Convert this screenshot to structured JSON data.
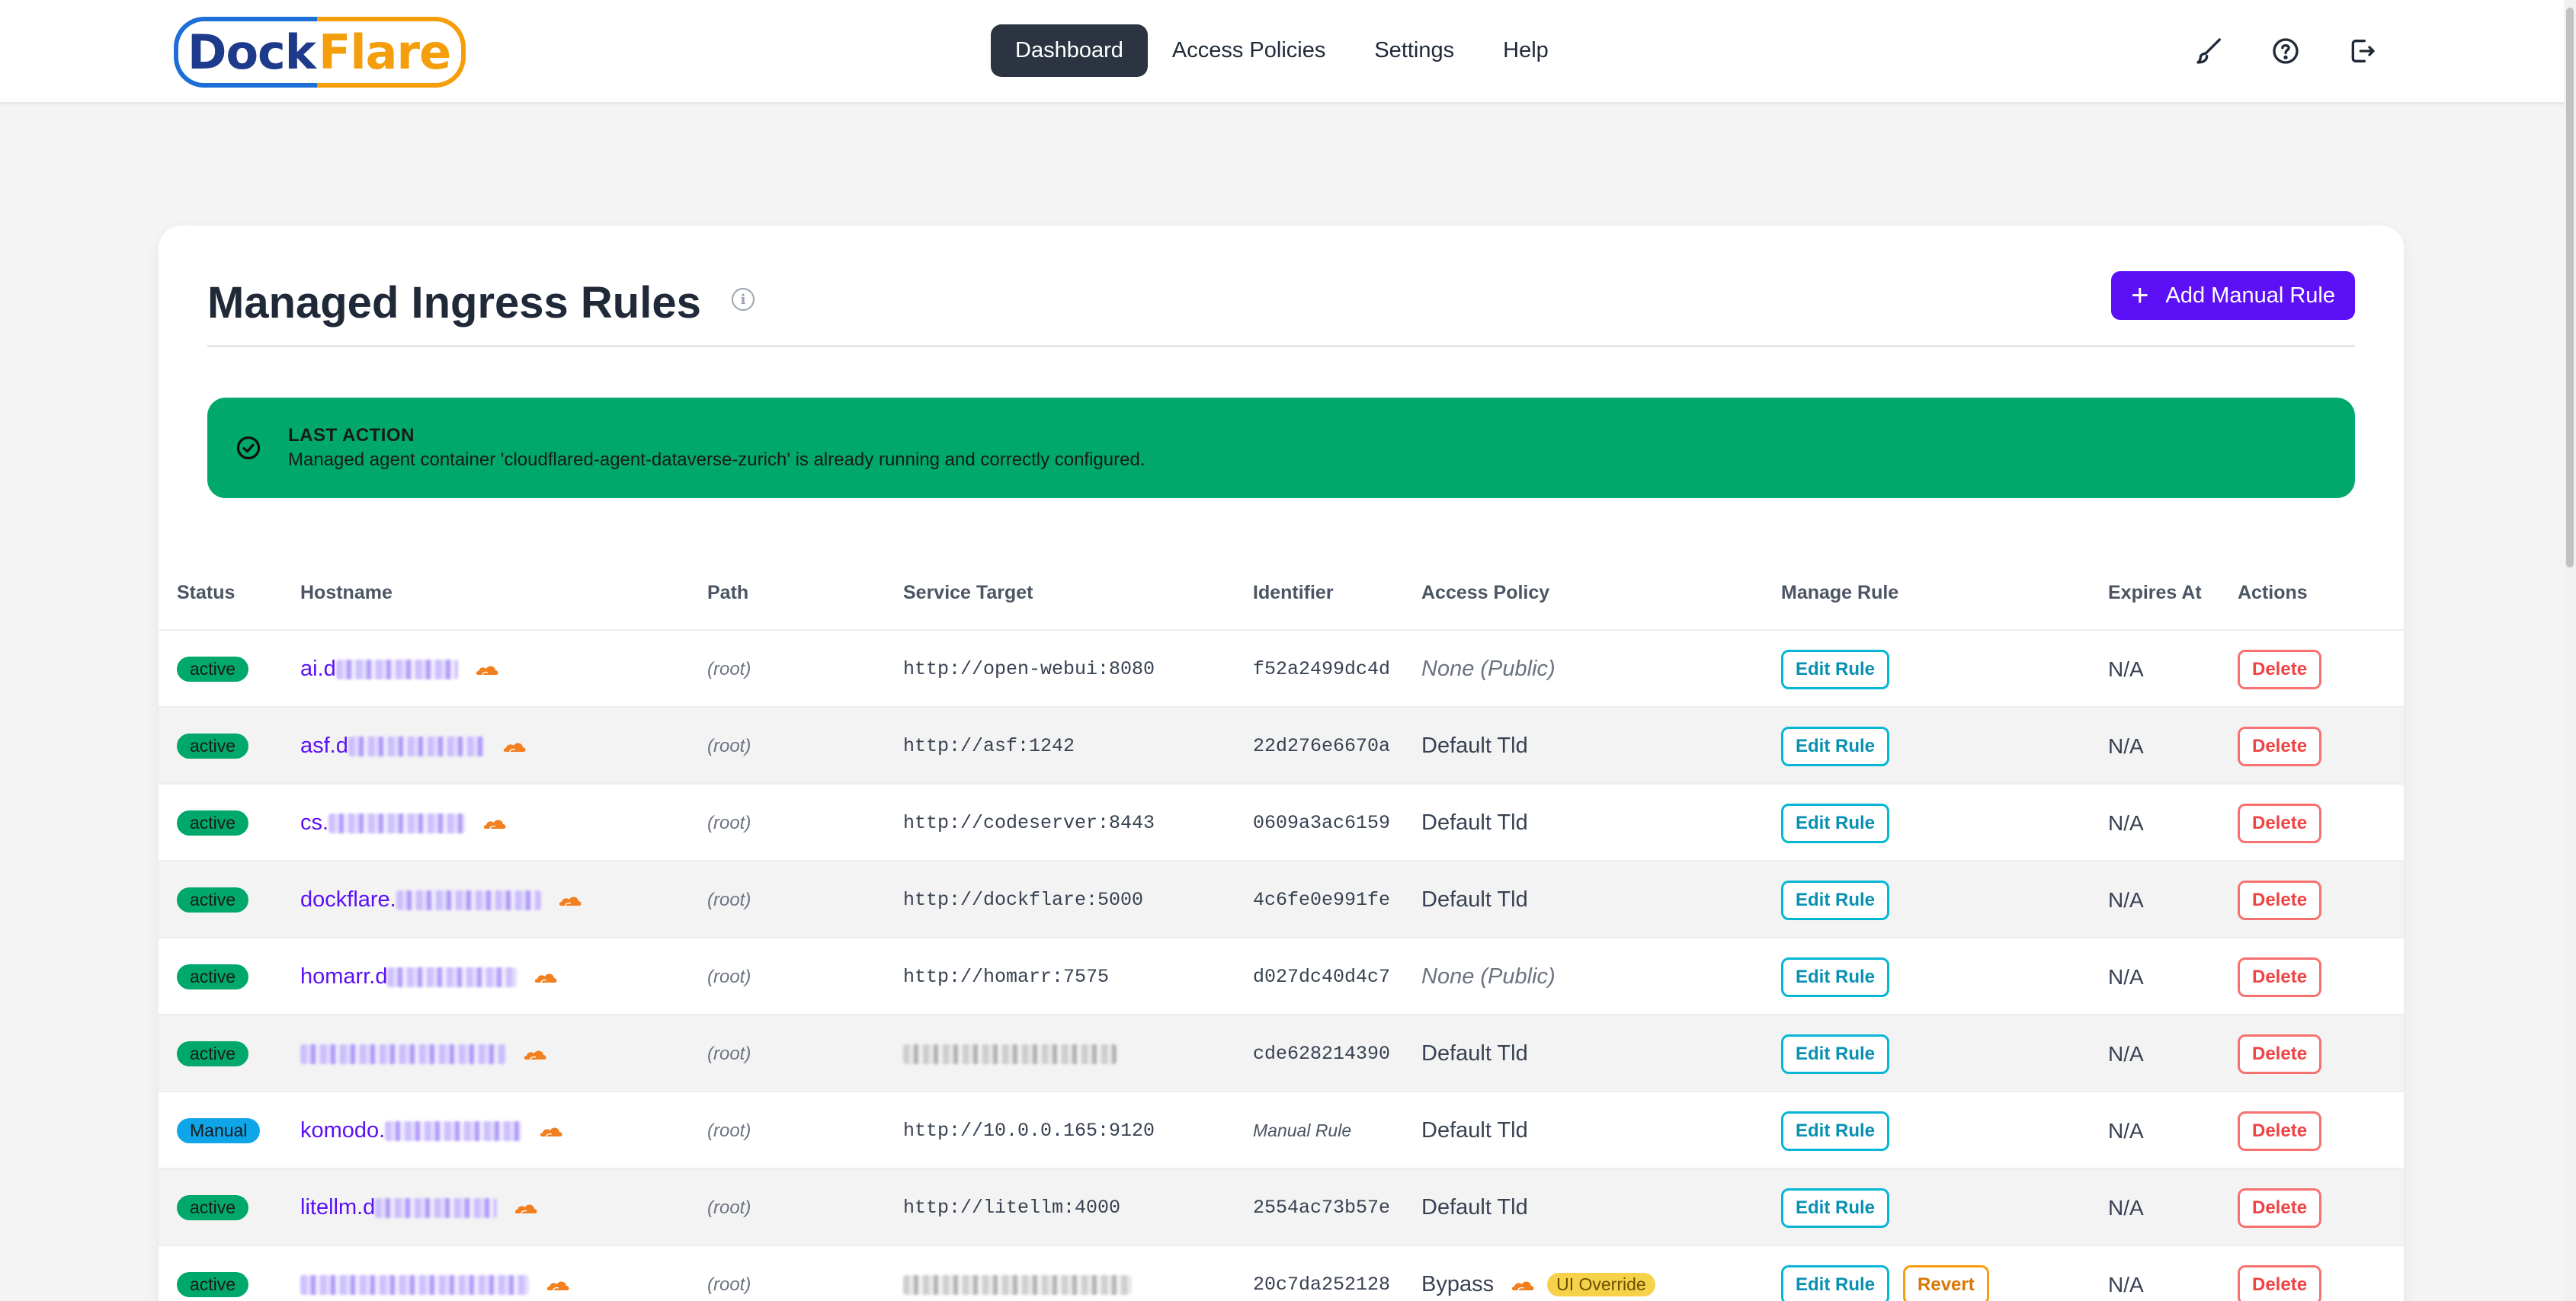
{
  "app": {
    "logo": {
      "part1": "Dock",
      "part2": "Flare"
    },
    "nav": [
      {
        "label": "Dashboard",
        "active": true
      },
      {
        "label": "Access Policies",
        "active": false
      },
      {
        "label": "Settings",
        "active": false
      },
      {
        "label": "Help",
        "active": false
      }
    ],
    "nav_icons": [
      "brush-icon",
      "help-circle-icon",
      "logout-icon"
    ]
  },
  "page": {
    "title": "Managed Ingress Rules",
    "info_icon_glyph": "i",
    "add_button": {
      "plus": "+",
      "label": "Add Manual Rule"
    }
  },
  "alert": {
    "title": "LAST ACTION",
    "message": "Managed agent container 'cloudflared-agent-dataverse-zurich' is already running and correctly configured.",
    "color": "#00a86b"
  },
  "table": {
    "columns": [
      "Status",
      "Hostname",
      "Path",
      "Service Target",
      "Identifier",
      "Access Policy",
      "Manage Rule",
      "Expires At",
      "Actions"
    ],
    "rows": [
      {
        "status": "active",
        "host_prefix": "ai.d",
        "path": "(root)",
        "service": "http://open-webui:8080",
        "identifier": "f52a2499dc4d",
        "policy": "None (Public)",
        "policy_public": true,
        "edit": "Edit Rule",
        "expires": "N/A",
        "delete": "Delete"
      },
      {
        "status": "active",
        "host_prefix": "asf.d",
        "path": "(root)",
        "service": "http://asf:1242",
        "identifier": "22d276e6670a",
        "policy": "Default Tld",
        "edit": "Edit Rule",
        "expires": "N/A",
        "delete": "Delete"
      },
      {
        "status": "active",
        "host_prefix": "cs.",
        "path": "(root)",
        "service": "http://codeserver:8443",
        "identifier": "0609a3ac6159",
        "policy": "Default Tld",
        "edit": "Edit Rule",
        "expires": "N/A",
        "delete": "Delete"
      },
      {
        "status": "active",
        "host_prefix": "dockflare.",
        "path": "(root)",
        "service": "http://dockflare:5000",
        "identifier": "4c6fe0e991fe",
        "policy": "Default Tld",
        "edit": "Edit Rule",
        "expires": "N/A",
        "delete": "Delete"
      },
      {
        "status": "active",
        "host_prefix": "homarr.d",
        "path": "(root)",
        "service": "http://homarr:7575",
        "identifier": "d027dc40d4c7",
        "policy": "None (Public)",
        "policy_public": true,
        "edit": "Edit Rule",
        "expires": "N/A",
        "delete": "Delete"
      },
      {
        "status": "active",
        "host_prefix": "",
        "path": "(root)",
        "service": "",
        "identifier": "cde628214390",
        "policy": "Default Tld",
        "edit": "Edit Rule",
        "expires": "N/A",
        "delete": "Delete"
      },
      {
        "status": "Manual",
        "host_prefix": "komodo.",
        "path": "(root)",
        "service": "http://10.0.0.165:9120",
        "identifier": "Manual Rule",
        "policy": "Default Tld",
        "edit": "Edit Rule",
        "expires": "N/A",
        "delete": "Delete"
      },
      {
        "status": "active",
        "host_prefix": "litellm.d",
        "path": "(root)",
        "service": "http://litellm:4000",
        "identifier": "2554ac73b57e",
        "policy": "Default Tld",
        "edit": "Edit Rule",
        "expires": "N/A",
        "delete": "Delete"
      },
      {
        "status": "active",
        "host_prefix": "",
        "path": "(root)",
        "service": "",
        "identifier": "20c7da252128",
        "policy": "Bypass",
        "override": "UI Override",
        "edit": "Edit Rule",
        "revert": "Revert",
        "expires": "N/A",
        "delete": "Delete"
      }
    ]
  },
  "colors": {
    "accent": "#5b10f5",
    "dark_nav": "#2b3440",
    "success": "#00a86b",
    "manual": "#0ea5e9",
    "cloudflare": "#f38020"
  }
}
